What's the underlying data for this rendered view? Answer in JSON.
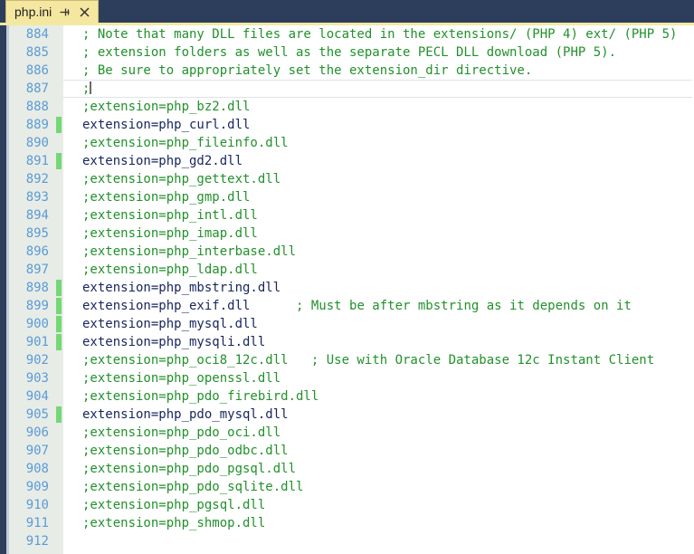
{
  "window": {
    "title": "php.ini",
    "colors": {
      "tabbar_bg": "#2d3e5c",
      "tab_bg": "#f5e7a0",
      "tab_underline": "#f2e9a0",
      "gutter_bg": "#e7ece7",
      "lineno_fg": "#5b9bd5",
      "comment_fg": "#21912b",
      "code_fg": "#17255e",
      "modified_marker": "#74d874",
      "editor_bg": "#ffffff"
    }
  },
  "tab": {
    "label": "php.ini",
    "pin_icon": "pin-icon",
    "close_icon": "close-icon"
  },
  "editor": {
    "first_line_number": 884,
    "lines": [
      {
        "n": 884,
        "modified": false,
        "current": false,
        "kind": "comment",
        "text": "; Note that many DLL files are located in the extensions/ (PHP 4) ext/ (PHP 5)"
      },
      {
        "n": 885,
        "modified": false,
        "current": false,
        "kind": "comment",
        "text": "; extension folders as well as the separate PECL DLL download (PHP 5)."
      },
      {
        "n": 886,
        "modified": false,
        "current": false,
        "kind": "comment",
        "text": "; Be sure to appropriately set the extension_dir directive."
      },
      {
        "n": 887,
        "modified": false,
        "current": true,
        "kind": "comment",
        "text": ";"
      },
      {
        "n": 888,
        "modified": false,
        "current": false,
        "kind": "comment",
        "text": ";extension=php_bz2.dll"
      },
      {
        "n": 889,
        "modified": true,
        "current": false,
        "kind": "code",
        "text": "extension=php_curl.dll"
      },
      {
        "n": 890,
        "modified": false,
        "current": false,
        "kind": "comment",
        "text": ";extension=php_fileinfo.dll"
      },
      {
        "n": 891,
        "modified": true,
        "current": false,
        "kind": "code",
        "text": "extension=php_gd2.dll"
      },
      {
        "n": 892,
        "modified": false,
        "current": false,
        "kind": "comment",
        "text": ";extension=php_gettext.dll"
      },
      {
        "n": 893,
        "modified": false,
        "current": false,
        "kind": "comment",
        "text": ";extension=php_gmp.dll"
      },
      {
        "n": 894,
        "modified": false,
        "current": false,
        "kind": "comment",
        "text": ";extension=php_intl.dll"
      },
      {
        "n": 895,
        "modified": false,
        "current": false,
        "kind": "comment",
        "text": ";extension=php_imap.dll"
      },
      {
        "n": 896,
        "modified": false,
        "current": false,
        "kind": "comment",
        "text": ";extension=php_interbase.dll"
      },
      {
        "n": 897,
        "modified": false,
        "current": false,
        "kind": "comment",
        "text": ";extension=php_ldap.dll"
      },
      {
        "n": 898,
        "modified": true,
        "current": false,
        "kind": "code",
        "text": "extension=php_mbstring.dll"
      },
      {
        "n": 899,
        "modified": true,
        "current": false,
        "kind": "code",
        "text": "extension=php_exif.dll",
        "trailing_comment": "      ; Must be after mbstring as it depends on it"
      },
      {
        "n": 900,
        "modified": true,
        "current": false,
        "kind": "code",
        "text": "extension=php_mysql.dll"
      },
      {
        "n": 901,
        "modified": true,
        "current": false,
        "kind": "code",
        "text": "extension=php_mysqli.dll"
      },
      {
        "n": 902,
        "modified": false,
        "current": false,
        "kind": "comment",
        "text": ";extension=php_oci8_12c.dll   ; Use with Oracle Database 12c Instant Client"
      },
      {
        "n": 903,
        "modified": false,
        "current": false,
        "kind": "comment",
        "text": ";extension=php_openssl.dll"
      },
      {
        "n": 904,
        "modified": false,
        "current": false,
        "kind": "comment",
        "text": ";extension=php_pdo_firebird.dll"
      },
      {
        "n": 905,
        "modified": true,
        "current": false,
        "kind": "code",
        "text": "extension=php_pdo_mysql.dll"
      },
      {
        "n": 906,
        "modified": false,
        "current": false,
        "kind": "comment",
        "text": ";extension=php_pdo_oci.dll"
      },
      {
        "n": 907,
        "modified": false,
        "current": false,
        "kind": "comment",
        "text": ";extension=php_pdo_odbc.dll"
      },
      {
        "n": 908,
        "modified": false,
        "current": false,
        "kind": "comment",
        "text": ";extension=php_pdo_pgsql.dll"
      },
      {
        "n": 909,
        "modified": false,
        "current": false,
        "kind": "comment",
        "text": ";extension=php_pdo_sqlite.dll"
      },
      {
        "n": 910,
        "modified": false,
        "current": false,
        "kind": "comment",
        "text": ";extension=php_pgsql.dll"
      },
      {
        "n": 911,
        "modified": false,
        "current": false,
        "kind": "comment",
        "text": ";extension=php_shmop.dll"
      },
      {
        "n": 912,
        "modified": false,
        "current": false,
        "kind": "comment",
        "text": ""
      }
    ]
  }
}
